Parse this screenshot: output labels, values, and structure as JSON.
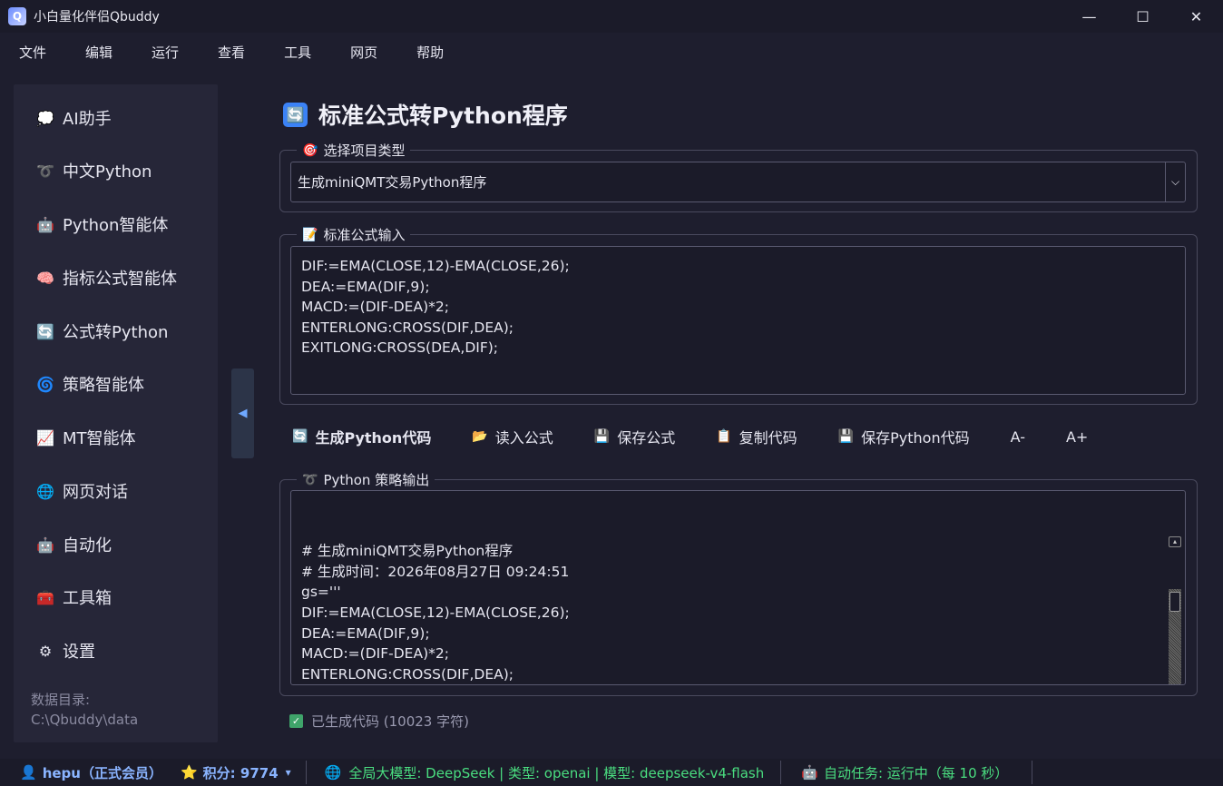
{
  "window": {
    "title": "小白量化伴侣Qbuddy",
    "app_icon": "Q",
    "minimize": "—",
    "maximize": "☐",
    "close": "✕"
  },
  "menu": [
    "文件",
    "编辑",
    "运行",
    "查看",
    "工具",
    "网页",
    "帮助"
  ],
  "sidebar": {
    "items": [
      {
        "label": "AI助手",
        "icon": "💭"
      },
      {
        "label": "中文Python",
        "icon": "➰"
      },
      {
        "label": "Python智能体",
        "icon": "🤖"
      },
      {
        "label": "指标公式智能体",
        "icon": "🧠"
      },
      {
        "label": "公式转Python",
        "icon": "🔄"
      },
      {
        "label": "策略智能体",
        "icon": "🌀"
      },
      {
        "label": "MT智能体",
        "icon": "📈"
      },
      {
        "label": "网页对话",
        "icon": "🌐"
      },
      {
        "label": "自动化",
        "icon": "🤖"
      },
      {
        "label": "工具箱",
        "icon": "🧰"
      },
      {
        "label": "设置",
        "icon": "⚙"
      }
    ],
    "data_dir_label": "数据目录:",
    "data_dir_path": "C:\\Qbuddy\\data",
    "collapse_glyph": "◀"
  },
  "page": {
    "title": "标准公式转Python程序",
    "title_icon": "🔄",
    "project_group": {
      "legend": "选择项目类型",
      "icon": "🎯",
      "selected": "生成miniQMT交易Python程序",
      "arrow": "⌵"
    },
    "input_group": {
      "legend": "标准公式输入",
      "icon": "📝",
      "text": "DIF:=EMA(CLOSE,12)-EMA(CLOSE,26);\nDEA:=EMA(DIF,9);\nMACD:=(DIF-DEA)*2;\nENTERLONG:CROSS(DIF,DEA);\nEXITLONG:CROSS(DEA,DIF);"
    },
    "toolbar": {
      "generate": {
        "label": "生成Python代码",
        "icon": "🔄"
      },
      "read": {
        "label": "读入公式",
        "icon": "📂"
      },
      "save_formula": {
        "label": "保存公式",
        "icon": "💾"
      },
      "copy": {
        "label": "复制代码",
        "icon": "📋"
      },
      "save_python": {
        "label": "保存Python代码",
        "icon": "💾"
      },
      "font_down": "A-",
      "font_up": "A+"
    },
    "output_group": {
      "legend": "Python 策略输出",
      "icon": "➰",
      "text": "# 生成miniQMT交易Python程序\n# 生成时间：2026年08月27日 09:24:51\ngs='''\nDIF:=EMA(CLOSE,12)-EMA(CLOSE,26);\nDEA:=EMA(DIF,9);\nMACD:=(DIF-DEA)*2;\nENTERLONG:CROSS(DIF,DEA);\nEXITLONG:CROSS(DEA,DIF);\n'''"
    },
    "status": {
      "check": "✓",
      "text": "已生成代码 (10023 字符)"
    }
  },
  "statusbar": {
    "user_icon": "👤",
    "user": "hepu（正式会员）",
    "points_icon": "⭐",
    "points": "积分: 9774",
    "points_arrow": "▾",
    "model_icon": "🌐",
    "model": "全局大模型: DeepSeek | 类型: openai | 模型: deepseek-v4-flash",
    "task_icon": "🤖",
    "task": "自动任务: 运行中（每 10 秒）"
  }
}
